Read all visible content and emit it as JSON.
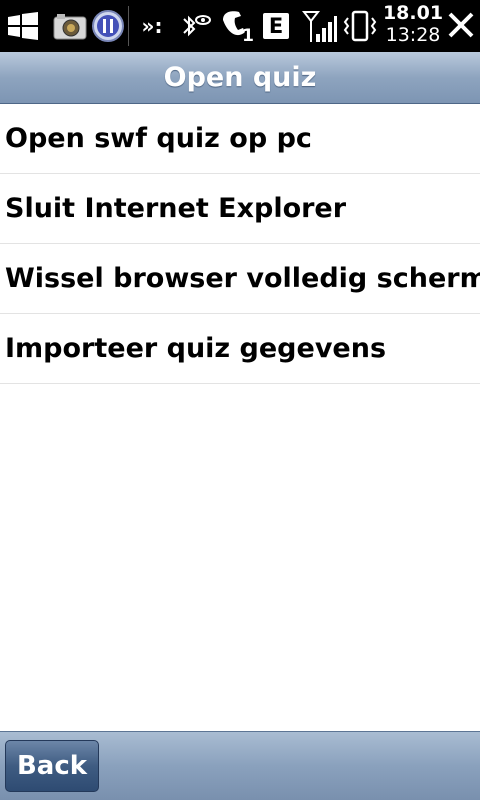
{
  "status_bar": {
    "icons": [
      "windows-start-icon",
      "camera-icon",
      "media-player-icon",
      "overflow-icon",
      "bluetooth-icon",
      "phone-icon",
      "edge-network-icon",
      "signal-strength-icon",
      "vibrate-icon"
    ],
    "overflow_glyph": "»:",
    "phone_line": "1",
    "network_letter": "E",
    "date": "18.01",
    "time": "13:28"
  },
  "header": {
    "title": "Open quiz"
  },
  "menu": {
    "items": [
      {
        "label": "Open swf quiz op pc"
      },
      {
        "label": "Sluit Internet Explorer"
      },
      {
        "label": "Wissel browser volledig scherm"
      },
      {
        "label": "Importeer quiz gegevens"
      }
    ]
  },
  "footer": {
    "back_label": "Back"
  },
  "colors": {
    "header_gradient_top": "#b9c9dc",
    "header_gradient_bottom": "#7d95b3",
    "button_blue": "#3f5c82"
  }
}
